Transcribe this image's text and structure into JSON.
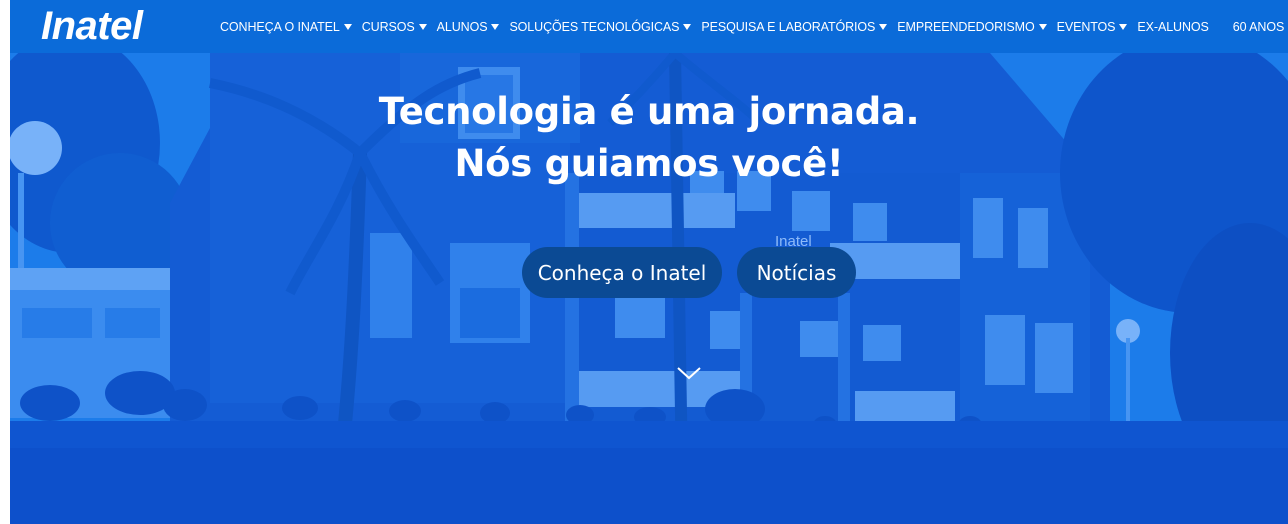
{
  "header": {
    "logo": "Inatel",
    "nav": [
      {
        "label": "CONHEÇA O INATEL",
        "dropdown": true
      },
      {
        "label": "CURSOS",
        "dropdown": true
      },
      {
        "label": "ALUNOS",
        "dropdown": true
      },
      {
        "label": "SOLUÇÕES TECNOLÓGICAS",
        "dropdown": true
      },
      {
        "label": "PESQUISA E LABORATÓRIOS",
        "dropdown": true
      },
      {
        "label": "EMPREENDEDORISMO",
        "dropdown": true
      },
      {
        "label": "EVENTOS",
        "dropdown": true
      },
      {
        "label": "EX-ALUNOS",
        "dropdown": false
      },
      {
        "label": "60 ANOS",
        "dropdown": false
      }
    ]
  },
  "hero": {
    "title_line1": "Tecnologia é uma jornada.",
    "title_line2": "Nós guiamos você!",
    "primary_button": "Conheça o Inatel",
    "secondary_button": "Notícias",
    "building_sign": "Inatel",
    "scroll_icon": "chevron-down-icon"
  },
  "colors": {
    "header_bg": "#0b6bd9",
    "hero_tint": "#1464eb",
    "button_bg": "#0b4a94",
    "text": "#ffffff"
  }
}
